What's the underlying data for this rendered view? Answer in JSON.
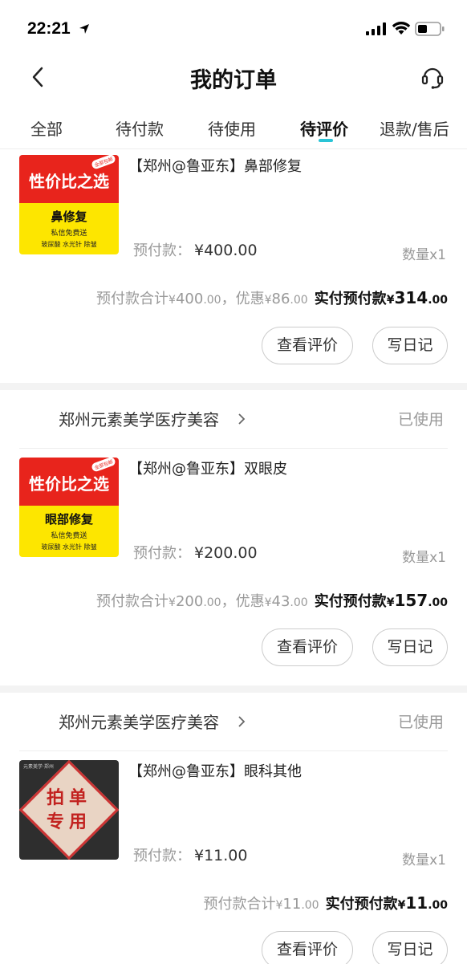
{
  "status_bar": {
    "time": "22:21"
  },
  "nav": {
    "title": "我的订单"
  },
  "tabs": [
    {
      "label": "全部"
    },
    {
      "label": "待付款"
    },
    {
      "label": "待使用"
    },
    {
      "label": "待评价"
    },
    {
      "label": "退款/售后"
    }
  ],
  "orders": [
    {
      "shop": "",
      "status": "",
      "thumbnail": {
        "style": "sale",
        "headline": "性价比之选",
        "badge": "全部包邮",
        "item": "鼻修复",
        "line1": "私信免费送",
        "line2": "玻尿酸 水光针 除皱"
      },
      "product_title": "【郑州@鲁亚东】鼻部修复",
      "prepay_label": "预付款：",
      "prepay_amount": "¥400.00",
      "quantity": "数量x1",
      "total_label": "预付款合计",
      "total_sym": "¥",
      "total_int": "400",
      "total_dec": ".00",
      "comma": "，",
      "discount_label": "优惠",
      "discount_sym": "¥",
      "discount_int": "86",
      "discount_dec": ".00",
      "final_label": "实付预付款",
      "final_sym": "¥",
      "final_int": "314",
      "final_dec": ".00",
      "btn_review": "查看评价",
      "btn_diary": "写日记"
    },
    {
      "shop": "郑州元素美学医疗美容",
      "status": "已使用",
      "thumbnail": {
        "style": "sale",
        "headline": "性价比之选",
        "badge": "全部包邮",
        "item": "眼部修复",
        "line1": "私信免费送",
        "line2": "玻尿酸 水光针 除皱"
      },
      "product_title": "【郑州@鲁亚东】双眼皮",
      "prepay_label": "预付款：",
      "prepay_amount": "¥200.00",
      "quantity": "数量x1",
      "total_label": "预付款合计",
      "total_sym": "¥",
      "total_int": "200",
      "total_dec": ".00",
      "comma": "，",
      "discount_label": "优惠",
      "discount_sym": "¥",
      "discount_int": "43",
      "discount_dec": ".00",
      "final_label": "实付预付款",
      "final_sym": "¥",
      "final_int": "157",
      "final_dec": ".00",
      "btn_review": "查看评价",
      "btn_diary": "写日记"
    },
    {
      "shop": "郑州元素美学医疗美容",
      "status": "已使用",
      "thumbnail": {
        "style": "stamp",
        "corner": "元素美学·郑州",
        "stamp_line1": "拍单",
        "stamp_line2": "专用"
      },
      "product_title": "【郑州@鲁亚东】眼科其他",
      "prepay_label": "预付款：",
      "prepay_amount": "¥11.00",
      "quantity": "数量x1",
      "total_label": "预付款合计",
      "total_sym": "¥",
      "total_int": "11",
      "total_dec": ".00",
      "final_label": "实付预付款",
      "final_sym": "¥",
      "final_int": "11",
      "final_dec": ".00",
      "btn_review": "查看评价",
      "btn_diary": "写日记"
    }
  ]
}
